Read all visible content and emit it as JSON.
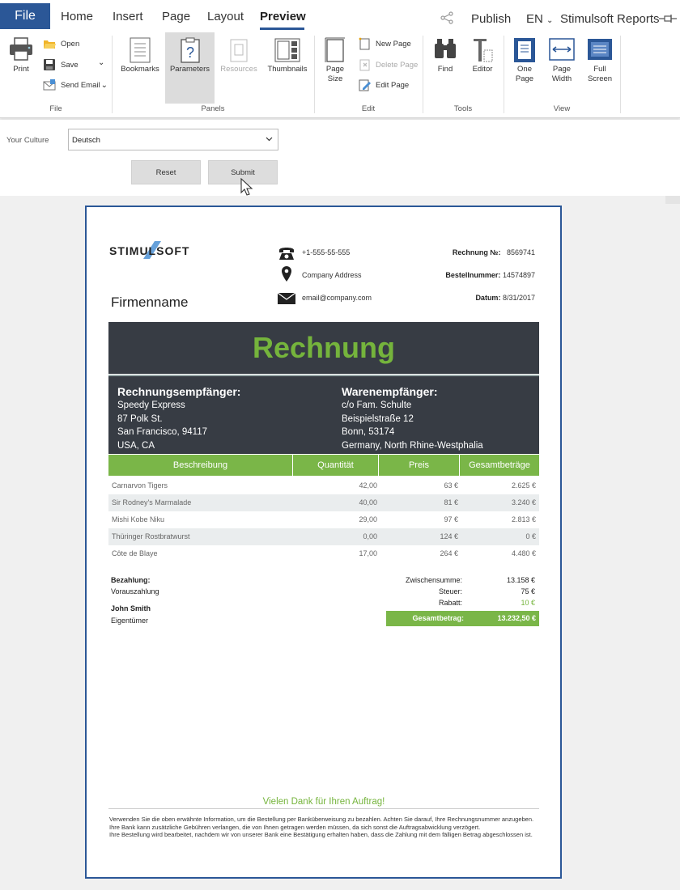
{
  "menu": {
    "file": "File",
    "tabs": [
      "Home",
      "Insert",
      "Page",
      "Layout",
      "Preview"
    ],
    "publish": "Publish",
    "language": "EN",
    "brand": "Stimulsoft Reports"
  },
  "ribbon": {
    "file_group": {
      "label": "File",
      "print": "Print",
      "open": "Open",
      "save": "Save",
      "send_email": "Send Email"
    },
    "panels_group": {
      "label": "Panels",
      "bookmarks": "Bookmarks",
      "parameters": "Parameters",
      "resources": "Resources",
      "thumbnails": "Thumbnails"
    },
    "edit_group": {
      "label": "Edit",
      "page_size": "Page Size",
      "new_page": "New Page",
      "delete_page": "Delete Page",
      "edit_page": "Edit Page"
    },
    "tools_group": {
      "label": "Tools",
      "find": "Find",
      "editor": "Editor"
    },
    "view_group": {
      "label": "View",
      "one_page": "One Page",
      "page_width": "Page Width",
      "full_screen": "Full Screen"
    }
  },
  "parameters": {
    "culture_label": "Your Culture",
    "culture_value": "Deutsch",
    "reset": "Reset",
    "submit": "Submit"
  },
  "report": {
    "logo": "STIMULSOFT",
    "firm": "Firmenname",
    "contact": {
      "phone": "+1-555-55-555",
      "address": "Company Address",
      "email": "email@company.com"
    },
    "meta": [
      {
        "label": "Rechnung №:",
        "value": "8569741"
      },
      {
        "label": "Bestellnummer:",
        "value": "14574897"
      },
      {
        "label": "Datum:",
        "value": "8/31/2017"
      }
    ],
    "title": "Rechnung",
    "billing": {
      "heading": "Rechnungsempfänger:",
      "lines": [
        "Speedy Express",
        "87 Polk St.",
        "San Francisco, 94117",
        "USA, CA"
      ]
    },
    "shipping": {
      "heading": "Warenempfänger:",
      "lines": [
        "c/o Fam. Schulte",
        "Beispielstraße 12",
        "Bonn, 53174",
        "Germany, North Rhine-Westphalia"
      ]
    },
    "table": {
      "headers": [
        "Beschreibung",
        "Quantität",
        "Preis",
        "Gesamtbeträge"
      ],
      "rows": [
        [
          "Carnarvon Tigers",
          "42,00",
          "63 €",
          "2.625 €"
        ],
        [
          "Sir Rodney's Marmalade",
          "40,00",
          "81 €",
          "3.240 €"
        ],
        [
          "Mishi Kobe Niku",
          "29,00",
          "97 €",
          "2.813 €"
        ],
        [
          "Thüringer Rostbratwurst",
          "0,00",
          "124 €",
          "0 €"
        ],
        [
          "Côte de Blaye",
          "17,00",
          "264 €",
          "4.480 €"
        ]
      ]
    },
    "payment": {
      "label": "Bezahlung:",
      "value": "Vorauszahlung"
    },
    "owner": {
      "name": "John Smith",
      "role": "Eigentümer"
    },
    "summary": [
      {
        "label": "Zwischensumme:",
        "value": "13.158 €"
      },
      {
        "label": "Steuer:",
        "value": "75 €"
      },
      {
        "label": "Rabatt:",
        "value": "10 €"
      }
    ],
    "total": {
      "label": "Gesamtbetrag:",
      "value": "13.232,50 €"
    },
    "thanks": "Vielen Dank für Ihren Auftrag!",
    "notes": [
      "Verwenden Sie die oben erwähnte Information, um die Bestellung per Banküberweisung zu bezahlen. Achten Sie darauf, Ihre Rechnungsnummer anzugeben.",
      "Ihre Bank kann zusätzliche Gebühren verlangen, die von Ihnen getragen werden müssen, da sich sonst die Auftragsabwicklung verzögert.",
      "Ihre Bestellung wird bearbeitet, nachdem wir von unserer Bank eine Bestätigung erhalten haben, dass die Zahlung mit dem fälligen Betrag abgeschlossen ist."
    ]
  },
  "colors": {
    "accent": "#2b5797",
    "green": "#7ab648",
    "dark_band": "#373c44"
  },
  "icons": [
    "share-icon",
    "pin-icon",
    "print-icon",
    "open-icon",
    "save-icon",
    "email-icon",
    "bookmarks-icon",
    "parameters-icon",
    "resources-icon",
    "thumbnails-icon",
    "page-size-icon",
    "new-page-icon",
    "delete-page-icon",
    "edit-page-icon",
    "find-icon",
    "editor-icon",
    "one-page-icon",
    "page-width-icon",
    "full-screen-icon",
    "phone-icon",
    "location-icon",
    "envelope-icon",
    "cursor-icon"
  ]
}
